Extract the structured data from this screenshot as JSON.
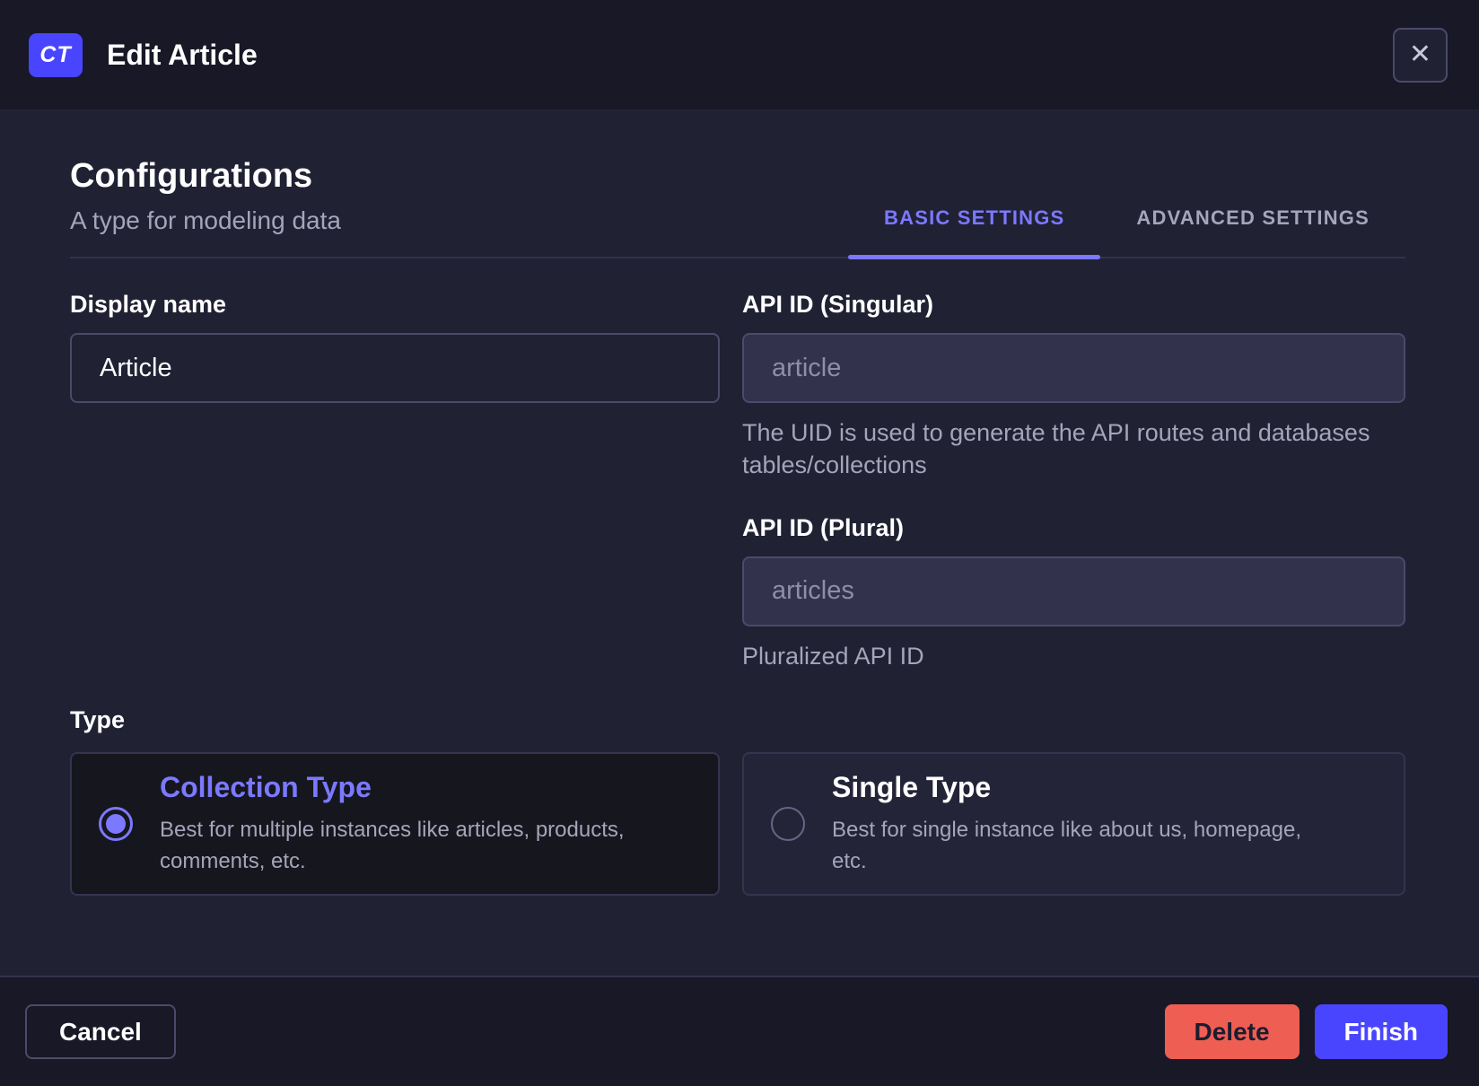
{
  "header": {
    "badge": "CT",
    "title": "Edit Article"
  },
  "icons": {
    "close": "✕"
  },
  "configurations": {
    "title": "Configurations",
    "subtitle": "A type for modeling data"
  },
  "tabs": [
    {
      "label": "BASIC SETTINGS",
      "active": true
    },
    {
      "label": "ADVANCED SETTINGS",
      "active": false
    }
  ],
  "form": {
    "display_name": {
      "label": "Display name",
      "value": "Article"
    },
    "api_id_singular": {
      "label": "API ID (Singular)",
      "placeholder": "article",
      "helper": "The UID is used to generate the API routes and databases tables/collections"
    },
    "api_id_plural": {
      "label": "API ID (Plural)",
      "placeholder": "articles",
      "helper": "Pluralized API ID"
    }
  },
  "type_section": {
    "label": "Type",
    "options": [
      {
        "title": "Collection Type",
        "description": "Best for multiple instances like articles, products, comments, etc.",
        "selected": true
      },
      {
        "title": "Single Type",
        "description": "Best for single instance like about us, homepage, etc.",
        "selected": false
      }
    ]
  },
  "footer": {
    "cancel": "Cancel",
    "delete": "Delete",
    "finish": "Finish"
  },
  "colors": {
    "primary": "#4945ff",
    "primary_light": "#7b79ff",
    "danger": "#ee5e52",
    "body_background": "#212134",
    "surface_dark": "#181826",
    "border": "#4a4a6a",
    "muted_text": "#a5a5ba"
  }
}
